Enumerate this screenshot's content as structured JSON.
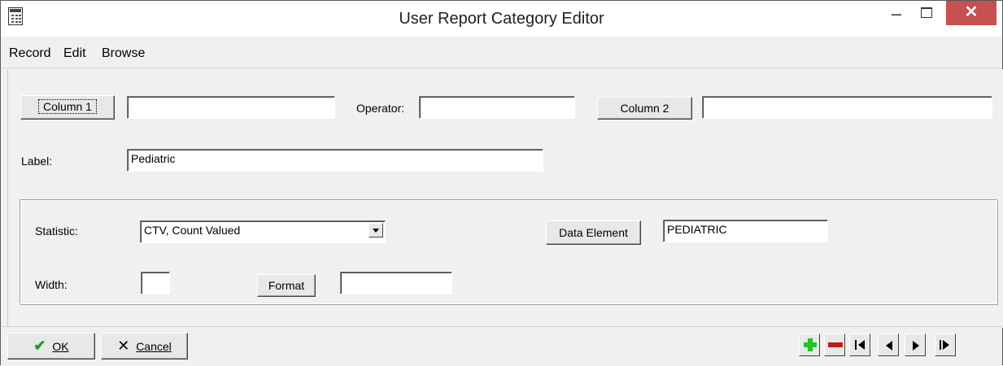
{
  "window": {
    "title": "User Report Category Editor"
  },
  "menu": {
    "items": [
      "Record",
      "Edit",
      "Browse"
    ]
  },
  "form": {
    "column1_button": "Column 1",
    "column1_value": "",
    "operator_label": "Operator:",
    "operator_value": "",
    "column2_button": "Column 2",
    "column2_value": "",
    "label_label": "Label:",
    "label_value": "Pediatric",
    "statistic_label": "Statistic:",
    "statistic_value": "CTV, Count Valued",
    "data_element_button": "Data Element",
    "data_element_value": "PEDIATRIC",
    "width_label": "Width:",
    "width_value": "",
    "format_button": "Format",
    "format_value": ""
  },
  "footer": {
    "ok_label": "OK",
    "cancel_label": "Cancel",
    "icons": [
      "add-record-icon",
      "delete-record-icon",
      "first-record-icon",
      "previous-record-icon",
      "next-record-icon",
      "last-record-icon"
    ]
  },
  "colors": {
    "close_button": "#c75050",
    "add_icon": "#22c322",
    "delete_icon": "#c21a1a",
    "ok_check": "#1e9e1e"
  }
}
